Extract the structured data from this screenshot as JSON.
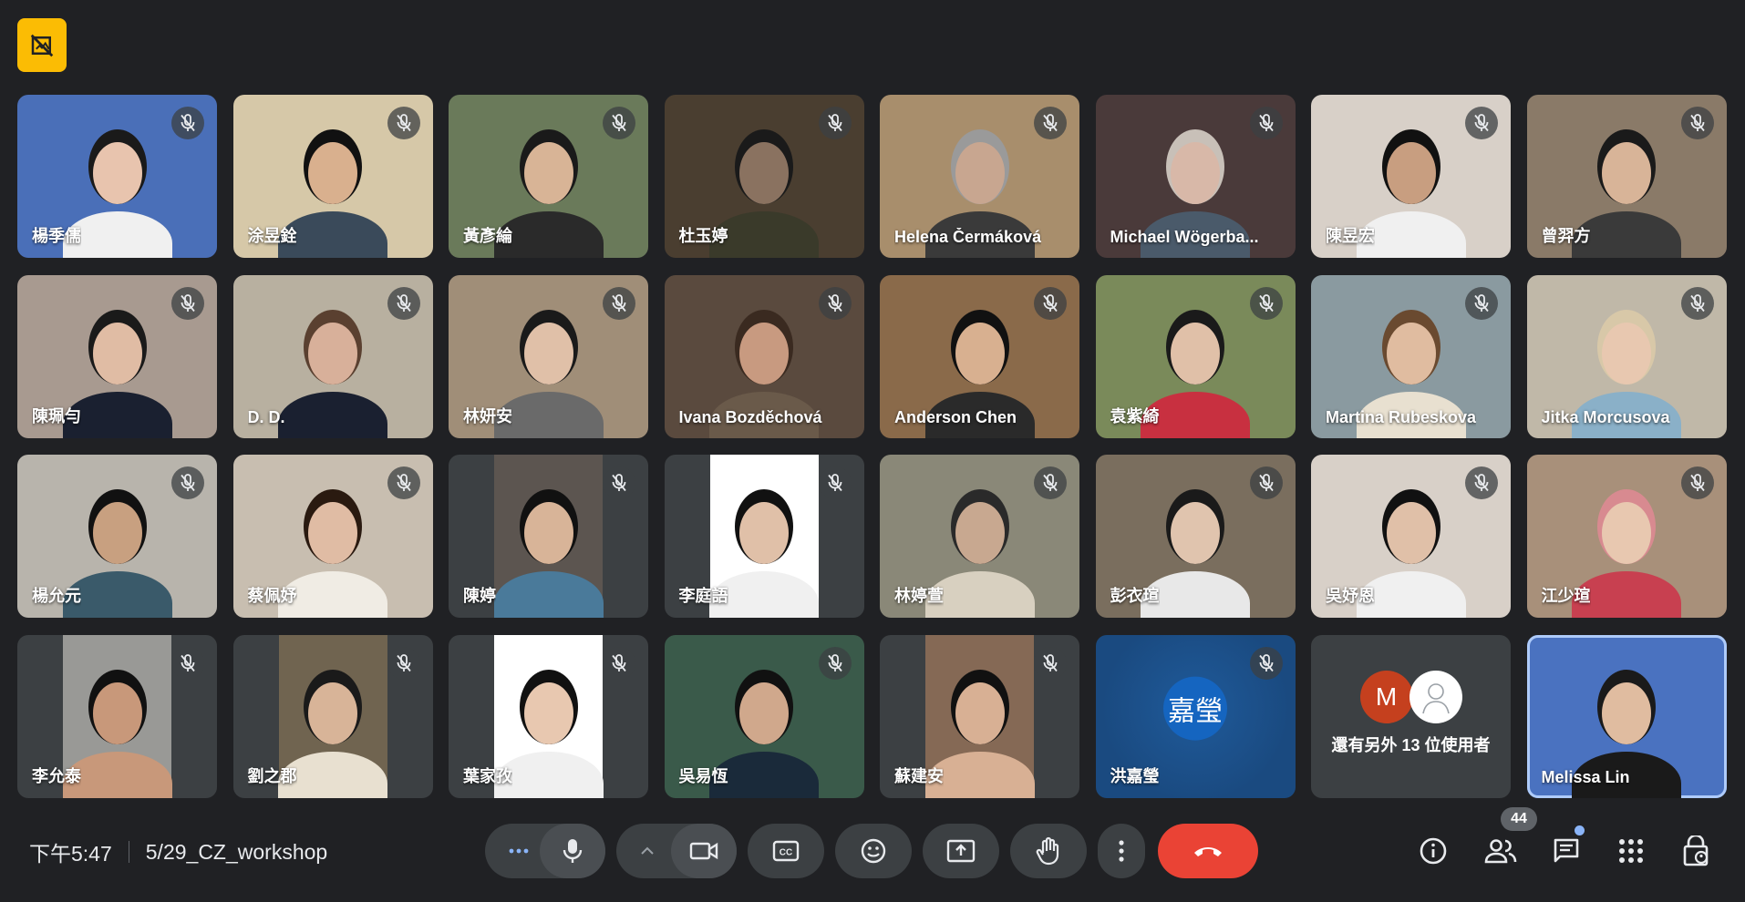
{
  "meeting": {
    "time": "下午5:47",
    "title": "5/29_CZ_workshop",
    "people_count": "44"
  },
  "participants": [
    {
      "name": "楊季儒",
      "bg": "#4a6fb8",
      "skin": "#e8c4ae",
      "hair": "#1a1a1a",
      "shirt": "#f0f0f0",
      "muted": true
    },
    {
      "name": "涂昱銓",
      "bg": "#d6c8a8",
      "skin": "#d9b08e",
      "hair": "#111111",
      "shirt": "#3a4a5a",
      "muted": true
    },
    {
      "name": "黃彥綸",
      "bg": "#6a7a5a",
      "skin": "#d8b496",
      "hair": "#1a1a1a",
      "shirt": "#2a2a2a",
      "muted": true
    },
    {
      "name": "杜玉婷",
      "bg": "#4a3e30",
      "skin": "#8a7260",
      "hair": "#1a1a1a",
      "shirt": "#3a3a2a",
      "muted": true
    },
    {
      "name": "Helena Čermáková",
      "bg": "#a88e6c",
      "skin": "#c8a690",
      "hair": "#9a9a9a",
      "shirt": "#3a3a3a",
      "muted": true
    },
    {
      "name": "Michael Wögerba...",
      "bg": "#4a3a3a",
      "skin": "#d8b8a8",
      "hair": "#c8c0b8",
      "shirt": "#4a5a6a",
      "muted": true
    },
    {
      "name": "陳昱宏",
      "bg": "#d8d0c8",
      "skin": "#c89e80",
      "hair": "#111111",
      "shirt": "#f0f0f0",
      "muted": true
    },
    {
      "name": "曾羿方",
      "bg": "#8a7a68",
      "skin": "#d8b498",
      "hair": "#1a1a1a",
      "shirt": "#3a3a3a",
      "muted": true
    },
    {
      "name": "陳珮勻",
      "bg": "#a89a90",
      "skin": "#e0bca4",
      "hair": "#1a1a1a",
      "shirt": "#1a2030",
      "muted": true
    },
    {
      "name": "D. D.",
      "bg": "#b8b0a0",
      "skin": "#d8b09a",
      "hair": "#5a4030",
      "shirt": "#1a2030",
      "muted": true
    },
    {
      "name": "林妍安",
      "bg": "#a08e78",
      "skin": "#e0c0a8",
      "hair": "#1a1a1a",
      "shirt": "#6a6a6a",
      "muted": true
    },
    {
      "name": "Ivana Bozděchová",
      "bg": "#5a4a3e",
      "skin": "#c89a80",
      "hair": "#3a2a20",
      "shirt": "#6a5a4a",
      "muted": true
    },
    {
      "name": "Anderson Chen",
      "bg": "#8a6a4a",
      "skin": "#d8b090",
      "hair": "#111111",
      "shirt": "#2a2a2a",
      "muted": true
    },
    {
      "name": "袁紫綺",
      "bg": "#7a8a5a",
      "skin": "#e0c0a8",
      "hair": "#1a1a1a",
      "shirt": "#c83040",
      "muted": true
    },
    {
      "name": "Martina Rubeskova",
      "bg": "#8a9aa0",
      "skin": "#e0bca0",
      "hair": "#6a4a30",
      "shirt": "#e8e0d0",
      "muted": true
    },
    {
      "name": "Jitka Morcusova",
      "bg": "#c0b8a8",
      "skin": "#e8c8b0",
      "hair": "#d8c8a8",
      "shirt": "#8ab0c8",
      "muted": true
    },
    {
      "name": "楊允元",
      "bg": "#b8b4ac",
      "skin": "#c8a080",
      "hair": "#111111",
      "shirt": "#3a5a6a",
      "muted": true
    },
    {
      "name": "蔡佩妤",
      "bg": "#c8beb0",
      "skin": "#e0bca4",
      "hair": "#2a1a10",
      "shirt": "#f0ece4",
      "muted": true
    },
    {
      "name": "陳婷",
      "bg": "#4a4440",
      "skin": "#d8b498",
      "hair": "#111111",
      "shirt": "#4a7a9a",
      "muted": true,
      "pillar": true
    },
    {
      "name": "李庭語",
      "bg": "#d8d8d8",
      "skin": "#e0c0a8",
      "hair": "#111111",
      "shirt": "#f0f0f0",
      "muted": true,
      "pillar": true
    },
    {
      "name": "林婷萱",
      "bg": "#8a8878",
      "skin": "#c8a890",
      "hair": "#2a2a2a",
      "shirt": "#d8d0c0",
      "muted": true
    },
    {
      "name": "彭衣瑄",
      "bg": "#7a6e5e",
      "skin": "#e0c4ae",
      "hair": "#1a1a1a",
      "shirt": "#e8e8e8",
      "muted": true
    },
    {
      "name": "吳妤恩",
      "bg": "#d8d0c8",
      "skin": "#e0c0a8",
      "hair": "#111111",
      "shirt": "#f0f0f0",
      "muted": true
    },
    {
      "name": "江少瑄",
      "bg": "#a8907a",
      "skin": "#e8c8b0",
      "hair": "#d88a90",
      "shirt": "#c84050",
      "muted": true
    },
    {
      "name": "李允泰",
      "bg": "#7a7a78",
      "skin": "#c8987a",
      "hair": "#111111",
      "shirt": "#c8987a",
      "muted": true,
      "pillar": true
    },
    {
      "name": "劉之郡",
      "bg": "#5a5040",
      "skin": "#d8b498",
      "hair": "#1a1a1a",
      "shirt": "#e8e0d0",
      "muted": true,
      "pillar": true
    },
    {
      "name": "葉家孜",
      "bg": "#d8d4cc",
      "skin": "#e8c8b0",
      "hair": "#111111",
      "shirt": "#f0f0f0",
      "muted": true,
      "pillar": true
    },
    {
      "name": "吳易恆",
      "bg": "#3a5a4a",
      "skin": "#d0a88c",
      "hair": "#111111",
      "shirt": "#1a2a3a",
      "muted": true
    },
    {
      "name": "蘇建安",
      "bg": "#6a5444",
      "skin": "#d8b094",
      "hair": "#111111",
      "shirt": "#d8b094",
      "muted": true,
      "pillar": true
    },
    {
      "name": "洪嘉瑩",
      "bg": "#1a4a80",
      "avatar_text": "嘉瑩",
      "muted": true,
      "avatar": true
    },
    {
      "others": true,
      "initial": "M",
      "label": "還有另外 13 位使用者"
    },
    {
      "name": "Melissa Lin",
      "bg": "#4a72c0",
      "skin": "#e0bca0",
      "hair": "#1a1a1a",
      "shirt": "#1a1a1a",
      "self": true
    }
  ],
  "icons": {
    "top_badge": "no-picture-icon",
    "more": "more-options-icon",
    "mic": "microphone-icon",
    "chevron": "chevron-up-icon",
    "camera": "camera-icon",
    "captions": "captions-icon",
    "emoji": "emoji-icon",
    "present": "present-screen-icon",
    "raise_hand": "raise-hand-icon",
    "kebab": "kebab-menu-icon",
    "end_call": "end-call-icon",
    "info": "info-icon",
    "people": "people-icon",
    "chat": "chat-icon",
    "activities": "apps-grid-icon",
    "host_controls": "lock-person-icon"
  },
  "colors": {
    "background": "#202124",
    "control": "#3c4043",
    "end_call": "#ea4335",
    "badge": "#fbbc04",
    "accent": "#8ab4f8"
  }
}
